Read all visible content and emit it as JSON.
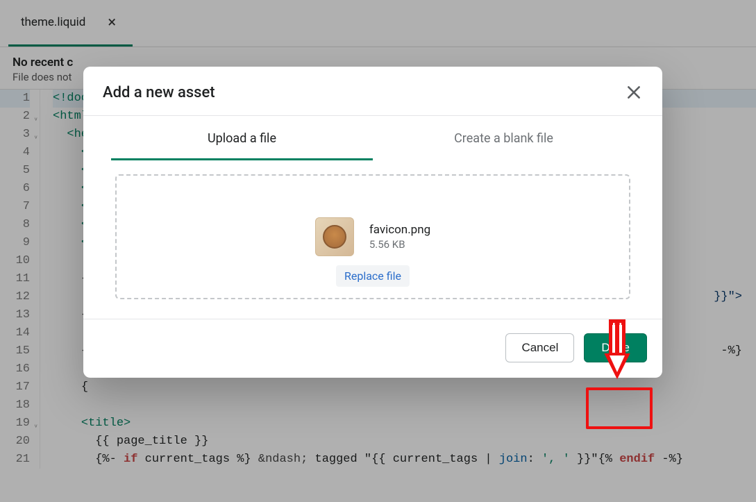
{
  "editor": {
    "tab_name": "theme.liquid",
    "notice_title": "No recent c",
    "notice_sub": "File does not",
    "lines": {
      "l1_a": "<!doc",
      "l2_a": "<html",
      "l3_a": "<he",
      "l4_a": "<",
      "l5_a": "<",
      "l6_a": "<",
      "l7_a": "<",
      "l8_a": "<",
      "l9_a": "<",
      "l10_a": "",
      "l11_a": "{",
      "l12_tail": "}}\">",
      "l13_a": "{",
      "l14_a": "",
      "l15_a": "{",
      "l15_tail": "-%}",
      "l16_a": "",
      "l17_a": "{",
      "l18_a": "",
      "l19_open": "<",
      "l19_tag": "title",
      "l19_close": ">",
      "l20": "{{ page_title }}",
      "l21_a": "{%- ",
      "l21_if": "if",
      "l21_b": " current_tags %} ",
      "l21_amp": "&ndash;",
      "l21_c": " tagged \"",
      "l21_d": "{{ current_tags | ",
      "l21_join": "join",
      "l21_e": ": ",
      "l21_str": "', '",
      "l21_f": " }}\"{% ",
      "l21_endif": "endif",
      "l21_g": " -%}"
    },
    "line_numbers": [
      "1",
      "2",
      "3",
      "4",
      "5",
      "6",
      "7",
      "8",
      "9",
      "10",
      "11",
      "12",
      "13",
      "14",
      "15",
      "16",
      "17",
      "18",
      "19",
      "20",
      "21"
    ]
  },
  "modal": {
    "title": "Add a new asset",
    "tab_upload": "Upload a file",
    "tab_blank": "Create a blank file",
    "file_name": "favicon.png",
    "file_size": "5.56 KB",
    "replace_label": "Replace file",
    "cancel_label": "Cancel",
    "done_label": "Done"
  }
}
